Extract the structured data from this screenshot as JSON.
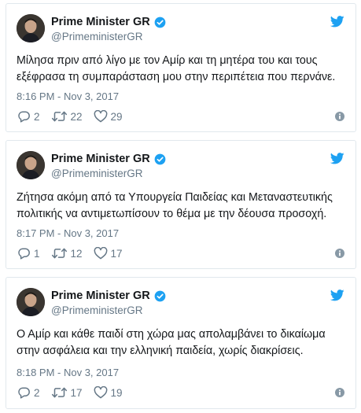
{
  "colors": {
    "twitter_blue": "#1da1f2",
    "text_primary": "#14171a",
    "text_secondary": "#657786",
    "border": "#e1e8ed"
  },
  "icons": [
    "verified-badge-icon",
    "twitter-bird-icon",
    "reply-icon",
    "retweet-icon",
    "like-icon",
    "info-icon"
  ],
  "tweets": [
    {
      "display_name": "Prime Minister GR",
      "handle": "@PrimeministerGR",
      "text_line1": "Μίλησα πριν από λίγο με τον Αμίρ και τη μητέρα του και τους",
      "text_line2": "εξέφρασα τη συμπαράσταση μου στην περιπέτεια που περνάνε.",
      "timestamp": "8:16 PM - Nov 3, 2017",
      "replies": "2",
      "retweets": "22",
      "likes": "29"
    },
    {
      "display_name": "Prime Minister GR",
      "handle": "@PrimeministerGR",
      "text_line1": "Ζήτησα ακόμη από τα Υπουργεία Παιδείας και Μεταναστευτικής",
      "text_line2": "πολιτικής να αντιμετωπίσουν το θέμα με την δέουσα προσοχή.",
      "timestamp": "8:17 PM - Nov 3, 2017",
      "replies": "1",
      "retweets": "12",
      "likes": "17"
    },
    {
      "display_name": "Prime Minister GR",
      "handle": "@PrimeministerGR",
      "text_line1": "Ο Αμίρ και κάθε παιδί στη χώρα μας απολαμβάνει το δικαίωμα",
      "text_line2": "στην ασφάλεια και την ελληνική παιδεία, χωρίς διακρίσεις.",
      "timestamp": "8:18 PM - Nov 3, 2017",
      "replies": "2",
      "retweets": "17",
      "likes": "19"
    }
  ]
}
